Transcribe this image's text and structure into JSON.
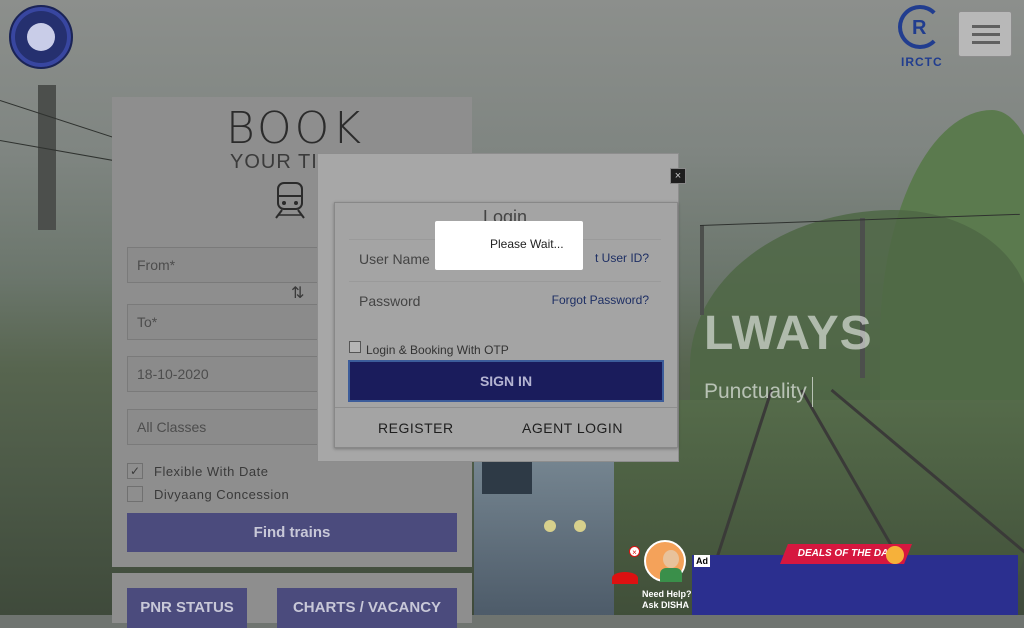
{
  "header": {
    "left_logo": "indian-railways-logo",
    "right_logo_text": "IRCTC",
    "menu_icon": "hamburger-menu-icon"
  },
  "hero": {
    "headline_fragment": "LWAYS",
    "subline_fragment": "Punctuality"
  },
  "booking": {
    "title": "BOOK",
    "subtitle": "YOUR TIC",
    "from_placeholder": "From*",
    "to_placeholder": "To*",
    "date_value": "18-10-2020",
    "class_value": "All Classes",
    "flexible_date_label": "Flexible With Date",
    "flexible_date_checked": true,
    "divyaang_label": "Divyaang Concession",
    "divyaang_checked": false,
    "find_button": "Find trains",
    "pnr_button": "PNR STATUS",
    "charts_button": "CHARTS / VACANCY"
  },
  "login_modal": {
    "close_label": "×",
    "title": "Login",
    "username_label": "User Name",
    "forgot_user_id": "t User ID?",
    "password_label": "Password",
    "forgot_password": "Forgot Password?",
    "otp_label": "Login & Booking With OTP",
    "otp_checked": false,
    "signin_button": "SIGN IN",
    "register_button": "REGISTER",
    "agent_login_button": "AGENT LOGIN"
  },
  "overlay": {
    "please_wait": "Please Wait..."
  },
  "ad": {
    "badge": "Ad",
    "deals_text": "DEALS OF THE DAY",
    "disha_help": "Need Help?",
    "disha_ask": "Ask DISHA"
  }
}
